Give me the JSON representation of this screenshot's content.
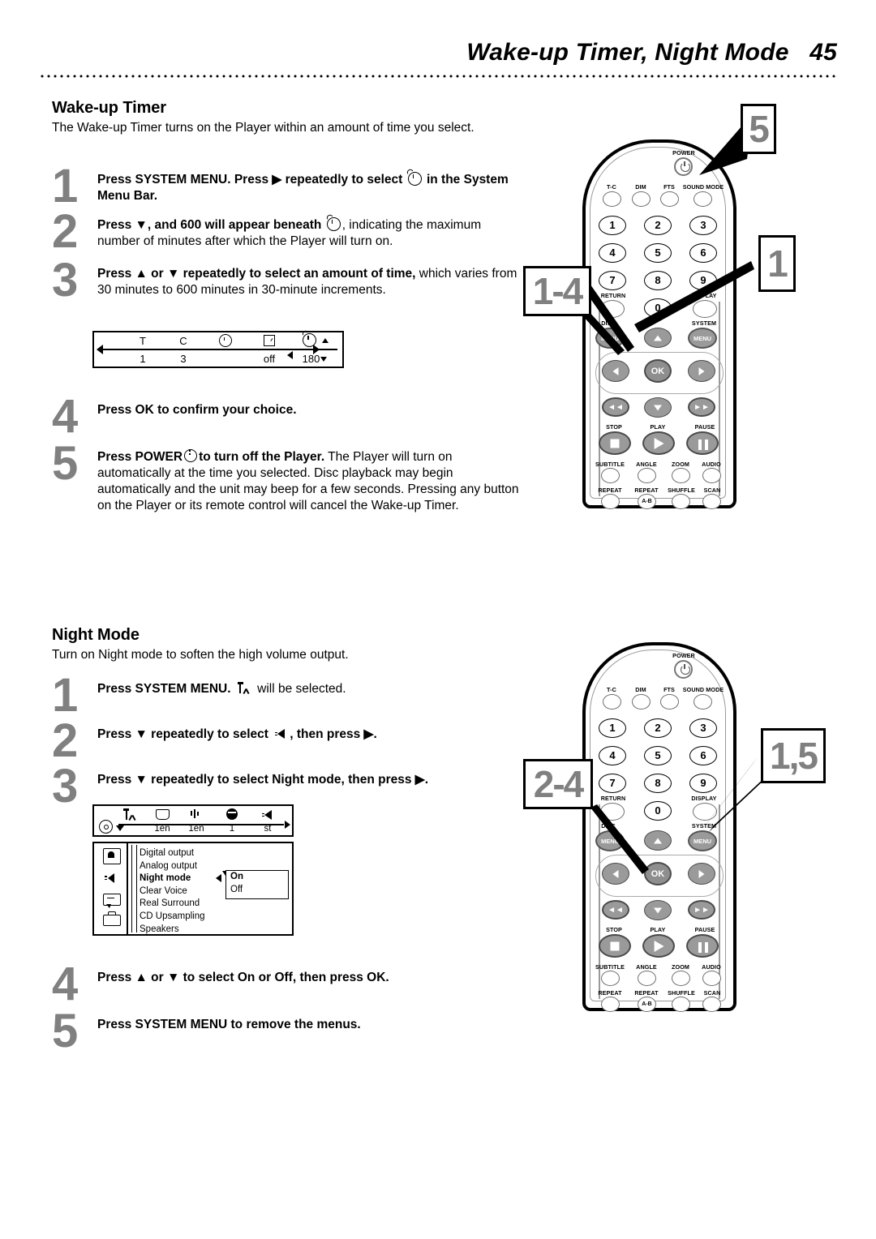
{
  "header": {
    "title": "Wake-up Timer, Night Mode",
    "page_number": "45"
  },
  "wakeup": {
    "heading": "Wake-up Timer",
    "intro": "The Wake-up Timer turns on the Player within an amount of time you select.",
    "steps": [
      {
        "num": "1",
        "bold1": "Press SYSTEM MENU. Press",
        "arrow": "▶",
        "bold2": "repeatedly to select",
        "icon": "timer-icon",
        "bold3": "in the System Menu Bar."
      },
      {
        "num": "2",
        "bold1": "Press ▼, and 600 will appear beneath",
        "icon": "timer-icon",
        "rest": ", indicating the maximum number of minutes after which the Player will turn on."
      },
      {
        "num": "3",
        "bold1": "Press ▲ or ▼ repeatedly to select an amount of time,",
        "rest": "which varies from 30 minutes to 600 minutes in 30-minute increments."
      },
      {
        "num": "4",
        "bold1": "Press OK",
        "rest": "to confirm your choice."
      },
      {
        "num": "5",
        "bold1": "Press POWER",
        "icon": "power-icon",
        "bold2": "to turn off the Player.",
        "rest": "The Player will turn on automatically at the time you selected. Disc playback may begin automatically and the unit may beep for a few seconds. Pressing any button on the Player or its remote control will cancel the Wake-up Timer."
      }
    ],
    "menu_bar": {
      "cells": [
        {
          "icon": "T",
          "value": "1"
        },
        {
          "icon": "C",
          "value": "3"
        },
        {
          "icon": "time-search-icon",
          "value": ""
        },
        {
          "icon": "checkbox-icon",
          "value": "off"
        },
        {
          "icon": "timer-icon",
          "value": "180"
        }
      ]
    }
  },
  "nightmode": {
    "heading": "Night Mode",
    "intro": "Turn on Night mode to soften the high volume output.",
    "steps": [
      {
        "num": "1",
        "bold1": "Press SYSTEM MENU.",
        "icon": "tools-icon",
        "rest": "will be selected."
      },
      {
        "num": "2",
        "bold1": "Press ▼ repeatedly to select",
        "icon": "speaker-icon",
        "bold2": ", then press ▶."
      },
      {
        "num": "3",
        "bold1": "Press ▼ repeatedly to select Night mode, then press ▶."
      },
      {
        "num": "4",
        "bold1": "Press ▲ or ▼ to select On or Off, then press OK."
      },
      {
        "num": "5",
        "bold1": "Press SYSTEM MENU to remove the menus."
      }
    ],
    "osd": {
      "bar_icons": [
        {
          "icon": "tools-icon",
          "value": ""
        },
        {
          "icon": "subtitle-icon",
          "value": "1en"
        },
        {
          "icon": "audio-lang-icon",
          "value": "1en"
        },
        {
          "icon": "angle-icon",
          "value": "1"
        },
        {
          "icon": "sound-icon",
          "value": "st"
        }
      ],
      "corner_icon": "disc-icon",
      "side_icons": [
        "picture-icon",
        "speaker-icon",
        "subtitle-bubble-icon",
        "features-icon"
      ],
      "list": [
        "Digital output",
        "Analog output",
        "Night mode",
        "Clear Voice",
        "Real Surround",
        "CD Upsampling",
        "Speakers"
      ],
      "selected_index": 2,
      "submenu": [
        "On",
        "Off"
      ],
      "submenu_selected_index": 0
    }
  },
  "remote": {
    "power_label": "POWER",
    "top_row": [
      "T-C",
      "DIM",
      "FTS",
      "SOUND MODE"
    ],
    "numbers": [
      "1",
      "2",
      "3",
      "4",
      "5",
      "6",
      "7",
      "8",
      "9",
      "0"
    ],
    "return_label": "RETURN",
    "display_label": "DISPLAY",
    "disc_label": "DISC",
    "system_label": "SYSTEM",
    "menu_label": "MENU",
    "ok_label": "OK",
    "transport_labels": [
      "STOP",
      "PLAY",
      "PAUSE"
    ],
    "func_row1": [
      "SUBTITLE",
      "ANGLE",
      "ZOOM",
      "AUDIO"
    ],
    "func_row2": [
      "REPEAT",
      "REPEAT",
      "SHUFFLE",
      "SCAN"
    ],
    "repeat_ab_label": "A-B"
  },
  "callouts": {
    "wakeup": [
      {
        "label": "5"
      },
      {
        "label": "1"
      },
      {
        "label": "1-4"
      }
    ],
    "nightmode": [
      {
        "label": "1,5"
      },
      {
        "label": "2-4"
      }
    ]
  }
}
